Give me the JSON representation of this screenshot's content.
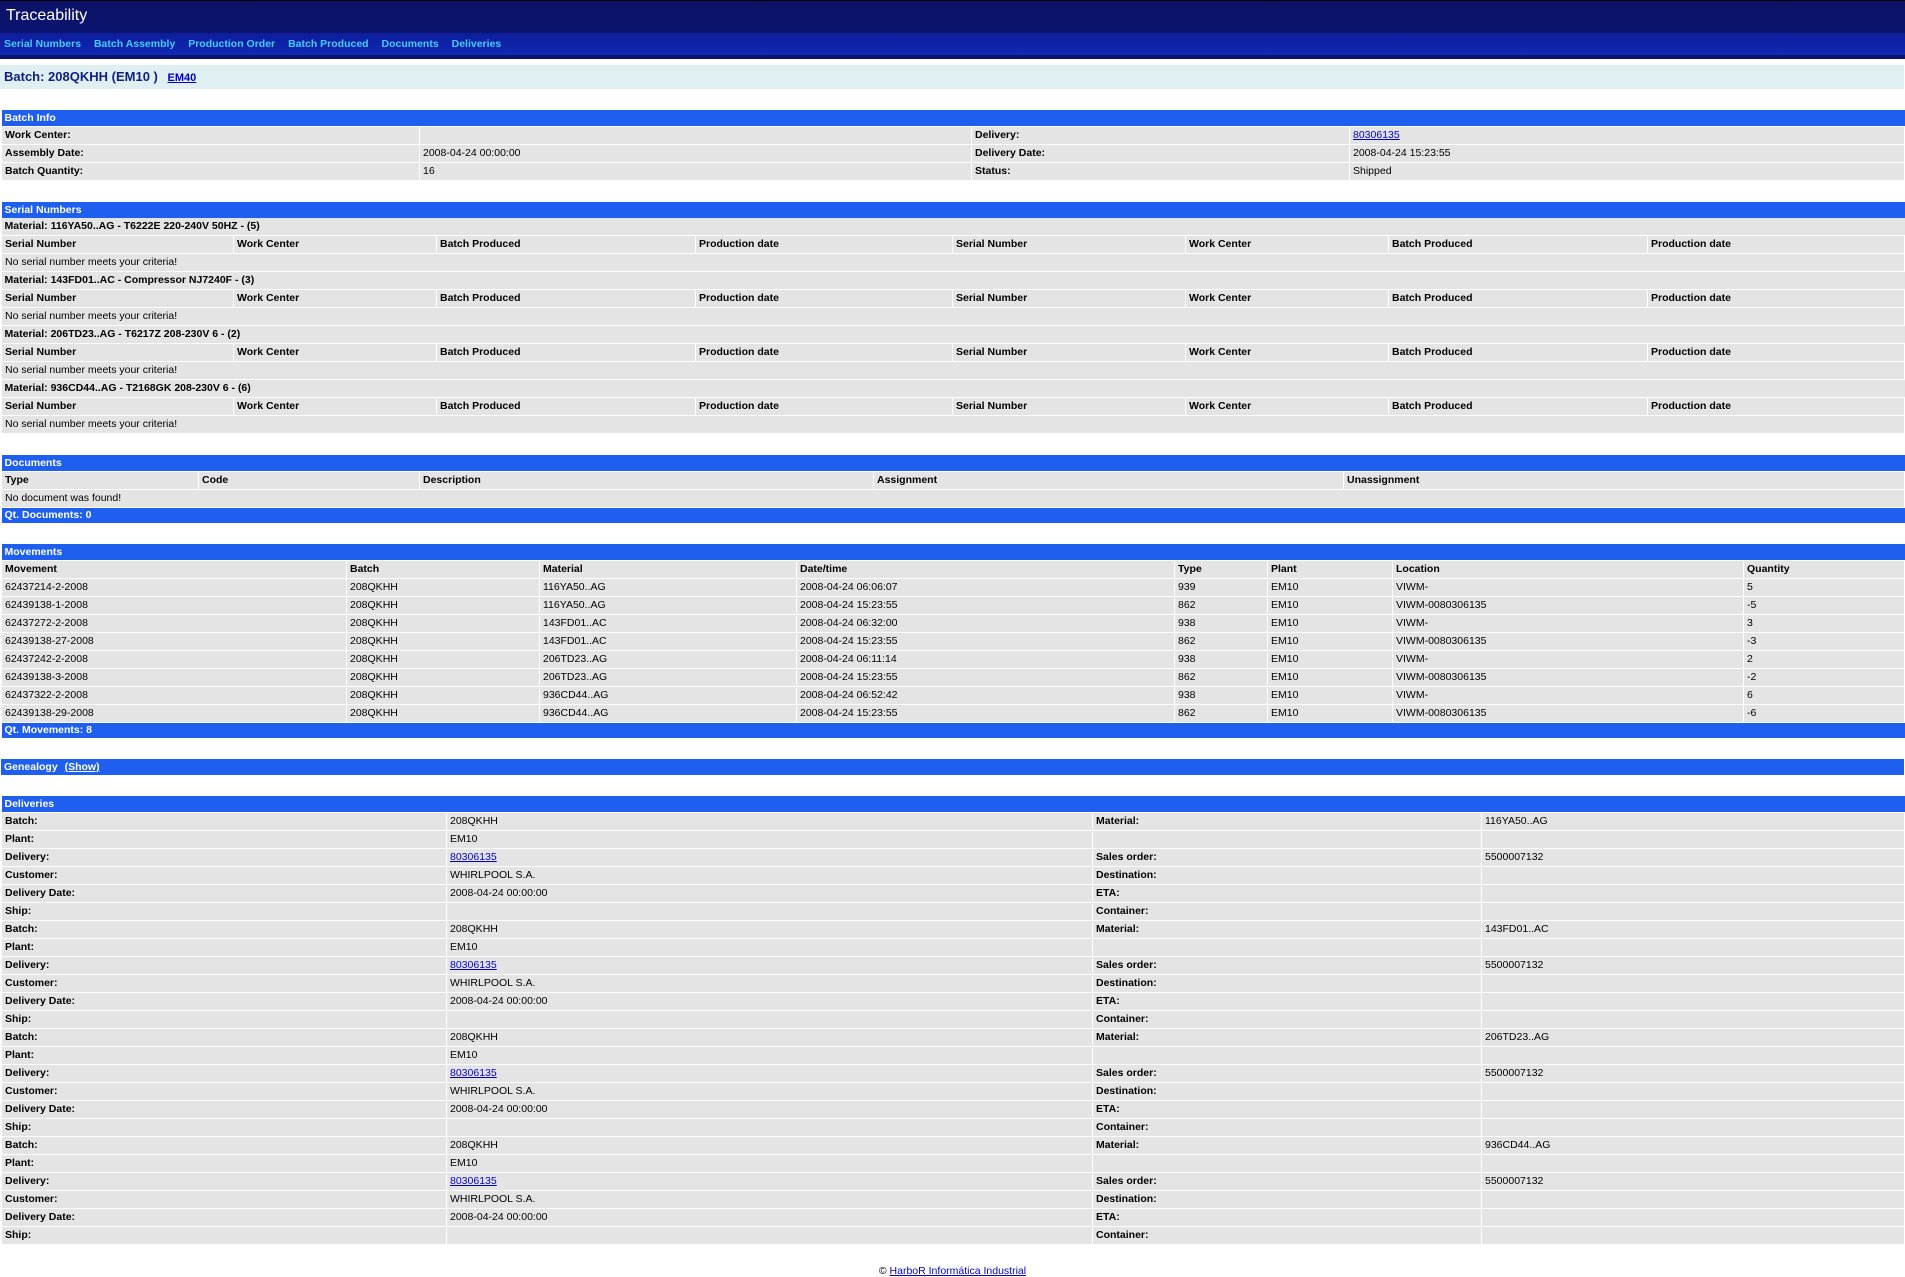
{
  "app": {
    "title": "Traceability"
  },
  "nav": [
    "Serial Numbers",
    "Batch Assembly",
    "Production Order",
    "Batch Produced",
    "Documents",
    "Deliveries"
  ],
  "batch": {
    "title": "Batch: 208QKHH (EM10 )",
    "link": "EM40"
  },
  "batch_info": {
    "heading": "Batch Info",
    "rows": [
      [
        "Work Center:",
        "",
        "Delivery:",
        "80306135"
      ],
      [
        "Assembly Date:",
        "2008-04-24 00:00:00",
        "Delivery Date:",
        "2008-04-24 15:23:55"
      ],
      [
        "Batch Quantity:",
        "16",
        "Status:",
        "Shipped"
      ]
    ]
  },
  "serial_numbers": {
    "heading": "Serial Numbers",
    "columns": [
      "Serial Number",
      "Work Center",
      "Batch Produced",
      "Production date",
      "Serial Number",
      "Work Center",
      "Batch Produced",
      "Production date"
    ],
    "empty_text": "No serial number meets your criteria!",
    "materials": [
      "Material: 116YA50..AG - T6222E 220-240V 50HZ - (5)",
      "Material: 143FD01..AC - Compressor NJ7240F - (3)",
      "Material: 206TD23..AG - T6217Z 208-230V 6 - (2)",
      "Material: 936CD44..AG - T2168GK 208-230V 6 - (6)"
    ]
  },
  "documents": {
    "heading": "Documents",
    "columns": [
      "Type",
      "Code",
      "Description",
      "Assignment",
      "Unassignment"
    ],
    "empty_text": "No document was found!",
    "footer": "Qt. Documents: 0"
  },
  "movements": {
    "heading": "Movements",
    "columns": [
      "Movement",
      "Batch",
      "Material",
      "Date/time",
      "Type",
      "Plant",
      "Location",
      "Quantity"
    ],
    "rows": [
      [
        "62437214-2-2008",
        "208QKHH",
        "116YA50..AG",
        "2008-04-24 06:06:07",
        "939",
        "EM10",
        "VIWM-",
        "5"
      ],
      [
        "62439138-1-2008",
        "208QKHH",
        "116YA50..AG",
        "2008-04-24 15:23:55",
        "862",
        "EM10",
        "VIWM-0080306135",
        "-5"
      ],
      [
        "62437272-2-2008",
        "208QKHH",
        "143FD01..AC",
        "2008-04-24 06:32:00",
        "938",
        "EM10",
        "VIWM-",
        "3"
      ],
      [
        "62439138-27-2008",
        "208QKHH",
        "143FD01..AC",
        "2008-04-24 15:23:55",
        "862",
        "EM10",
        "VIWM-0080306135",
        "-3"
      ],
      [
        "62437242-2-2008",
        "208QKHH",
        "206TD23..AG",
        "2008-04-24 06:11:14",
        "938",
        "EM10",
        "VIWM-",
        "2"
      ],
      [
        "62439138-3-2008",
        "208QKHH",
        "206TD23..AG",
        "2008-04-24 15:23:55",
        "862",
        "EM10",
        "VIWM-0080306135",
        "-2"
      ],
      [
        "62437322-2-2008",
        "208QKHH",
        "936CD44..AG",
        "2008-04-24 06:52:42",
        "938",
        "EM10",
        "VIWM-",
        "6"
      ],
      [
        "62439138-29-2008",
        "208QKHH",
        "936CD44..AG",
        "2008-04-24 15:23:55",
        "862",
        "EM10",
        "VIWM-0080306135",
        "-6"
      ]
    ],
    "footer": "Qt. Movements: 8"
  },
  "genealogy": {
    "heading": "Genealogy",
    "link": "(Show)"
  },
  "deliveries": {
    "heading": "Deliveries",
    "labels": {
      "batch": "Batch:",
      "plant": "Plant:",
      "delivery": "Delivery:",
      "customer": "Customer:",
      "delivery_date": "Delivery Date:",
      "ship": "Ship:",
      "material": "Material:",
      "sales_order": "Sales order:",
      "destination": "Destination:",
      "eta": "ETA:",
      "container": "Container:"
    },
    "items": [
      {
        "batch": "208QKHH",
        "plant": "EM10",
        "delivery": "80306135",
        "customer": "WHIRLPOOL S.A.",
        "delivery_date": "2008-04-24 00:00:00",
        "ship": "",
        "material": "116YA50..AG",
        "sales_order": "5500007132",
        "destination": "",
        "eta": "",
        "container": ""
      },
      {
        "batch": "208QKHH",
        "plant": "EM10",
        "delivery": "80306135",
        "customer": "WHIRLPOOL S.A.",
        "delivery_date": "2008-04-24 00:00:00",
        "ship": "",
        "material": "143FD01..AC",
        "sales_order": "5500007132",
        "destination": "",
        "eta": "",
        "container": ""
      },
      {
        "batch": "208QKHH",
        "plant": "EM10",
        "delivery": "80306135",
        "customer": "WHIRLPOOL S.A.",
        "delivery_date": "2008-04-24 00:00:00",
        "ship": "",
        "material": "206TD23..AG",
        "sales_order": "5500007132",
        "destination": "",
        "eta": "",
        "container": ""
      },
      {
        "batch": "208QKHH",
        "plant": "EM10",
        "delivery": "80306135",
        "customer": "WHIRLPOOL S.A.",
        "delivery_date": "2008-04-24 00:00:00",
        "ship": "",
        "material": "936CD44..AG",
        "sales_order": "5500007132",
        "destination": "",
        "eta": "",
        "container": ""
      }
    ]
  },
  "footer": {
    "copyright": "©",
    "link": "HarboR Informática Industrial"
  }
}
